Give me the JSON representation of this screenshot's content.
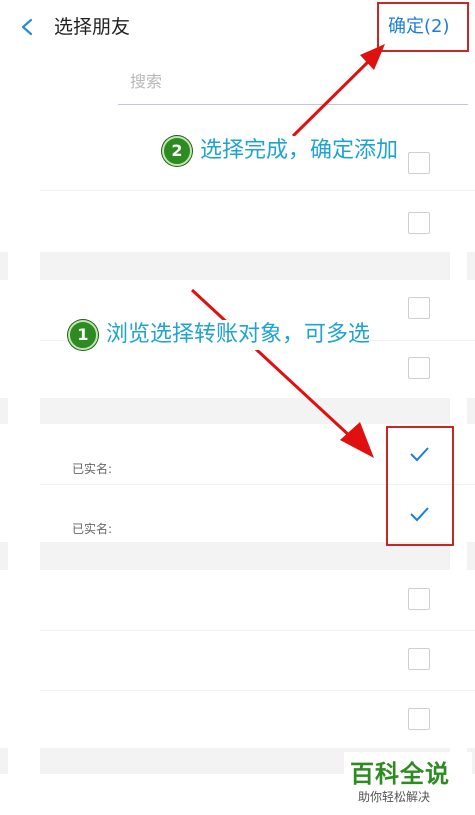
{
  "header": {
    "title": "选择朋友",
    "confirm_label": "确定(2)"
  },
  "search": {
    "placeholder": "搜索"
  },
  "contacts": [
    {
      "checked": false
    },
    {
      "checked": false
    },
    {
      "checked": false
    },
    {
      "checked": false
    },
    {
      "verified_label": "已实名:",
      "checked": true
    },
    {
      "verified_label": "已实名:",
      "checked": true
    },
    {
      "checked": false
    },
    {
      "checked": false
    },
    {
      "checked": false
    }
  ],
  "annotations": {
    "step1_number": "1",
    "step1_text": "浏览选择转账对象，可多选",
    "step2_number": "2",
    "step2_text": "选择完成，确定添加",
    "accent_color": "#c62828"
  },
  "watermark": {
    "main": "百科全说",
    "sub": "助你轻松解决"
  },
  "icons": {
    "back": "chevron-left-icon",
    "check": "checkmark-icon"
  }
}
